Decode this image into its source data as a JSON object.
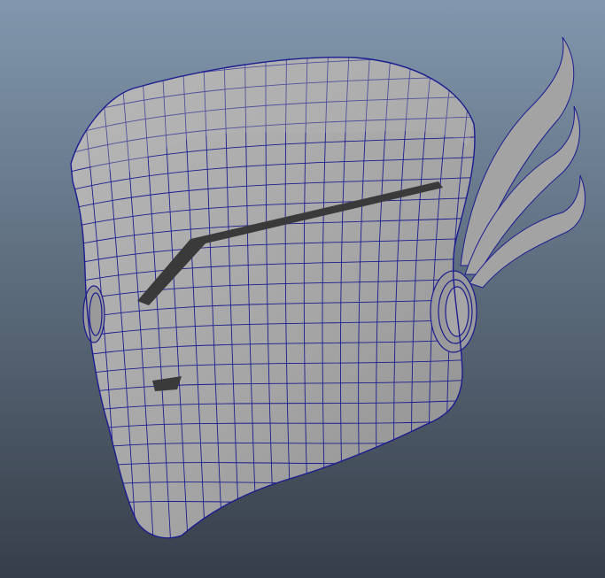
{
  "viewport": {
    "background_top": "#8197ad",
    "background_bottom": "#363e49",
    "mesh_fill": "#a9a9a9",
    "mesh_shadow": "#7d7d7d",
    "wire_color": "#1c1c90",
    "slot_color": "#3a3a3a"
  }
}
